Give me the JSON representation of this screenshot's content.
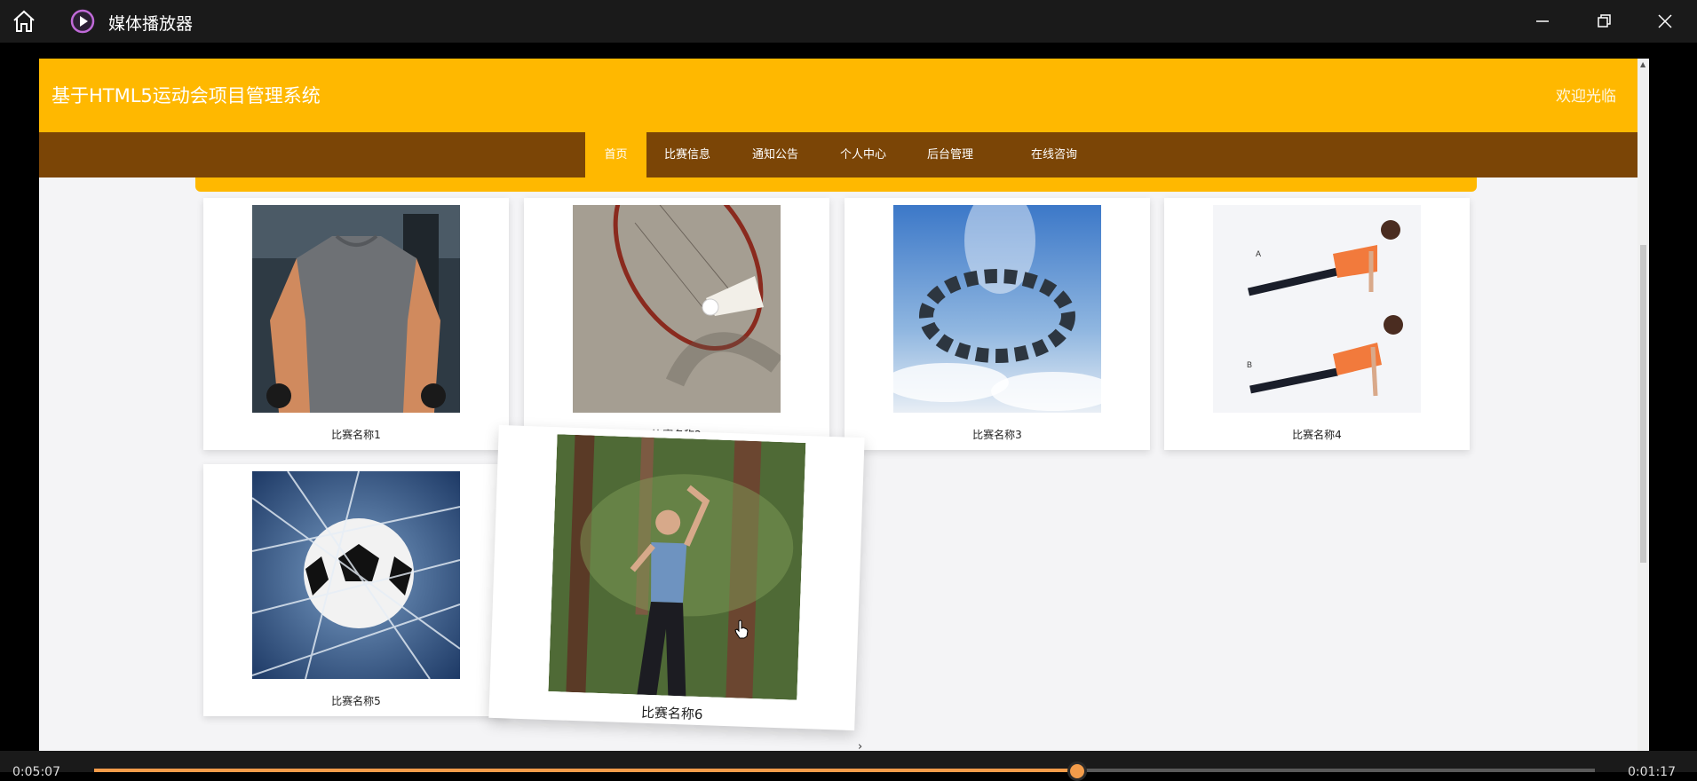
{
  "player": {
    "title": "媒体播放器",
    "current_time": "0:05:07",
    "total_time": "0:01:17",
    "progress": 0.655,
    "accent_color": "#f39c4a",
    "icons": [
      "home-icon",
      "play-logo-icon",
      "minimize-icon",
      "restore-icon",
      "close-icon"
    ]
  },
  "site": {
    "title": "基于HTML5运动会项目管理系统",
    "welcome": "欢迎光临",
    "header_color": "#ffb800",
    "nav_color": "#7b4506",
    "nav": [
      {
        "label": "首页",
        "active": true
      },
      {
        "label": "比赛信息",
        "active": false
      },
      {
        "label": "通知公告",
        "active": false
      },
      {
        "label": "个人中心",
        "active": false
      },
      {
        "label": "后台管理",
        "active": false
      },
      {
        "label": "在线咨询",
        "active": false
      }
    ],
    "cards": [
      {
        "label": "比赛名称1",
        "image": "muscular man in grey t-shirt at gym"
      },
      {
        "label": "比赛名称2",
        "image": "badminton racket and shuttlecock"
      },
      {
        "label": "比赛名称3",
        "image": "skydivers formation in sky"
      },
      {
        "label": "比赛名称4",
        "image": "woman doing push-up A/B"
      },
      {
        "label": "比赛名称5",
        "image": "soccer ball in net"
      },
      {
        "label": "比赛名称6",
        "image": "woman stretching in forest"
      }
    ],
    "pushup_labels": [
      "A",
      "B"
    ],
    "next_arrow": "›"
  }
}
